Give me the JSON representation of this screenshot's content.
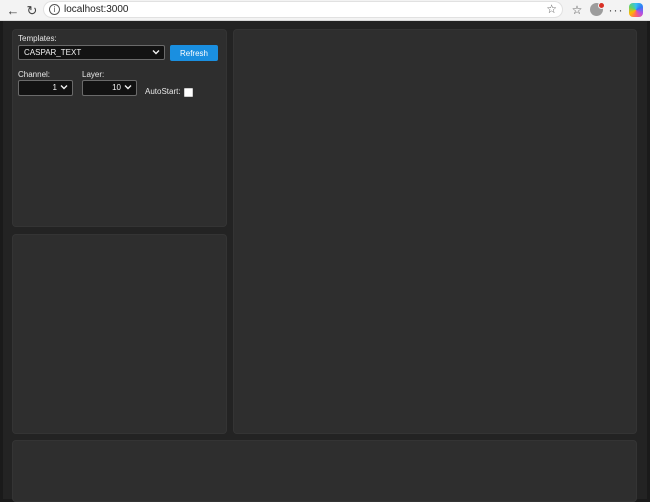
{
  "browser": {
    "url": "localhost:3000"
  },
  "controls": {
    "templates_label": "Templates:",
    "template_selected": "CASPAR_TEXT",
    "refresh_label": "Refresh",
    "channel_label": "Channel:",
    "channel_selected": "1",
    "layer_label": "Layer:",
    "layer_selected": "10",
    "autostart_label": "AutoStart:",
    "autostart_checked": false
  },
  "colors": {
    "page_background": "#232323",
    "panel_background": "#2e2e2e",
    "accent": "#1a8fe0"
  }
}
